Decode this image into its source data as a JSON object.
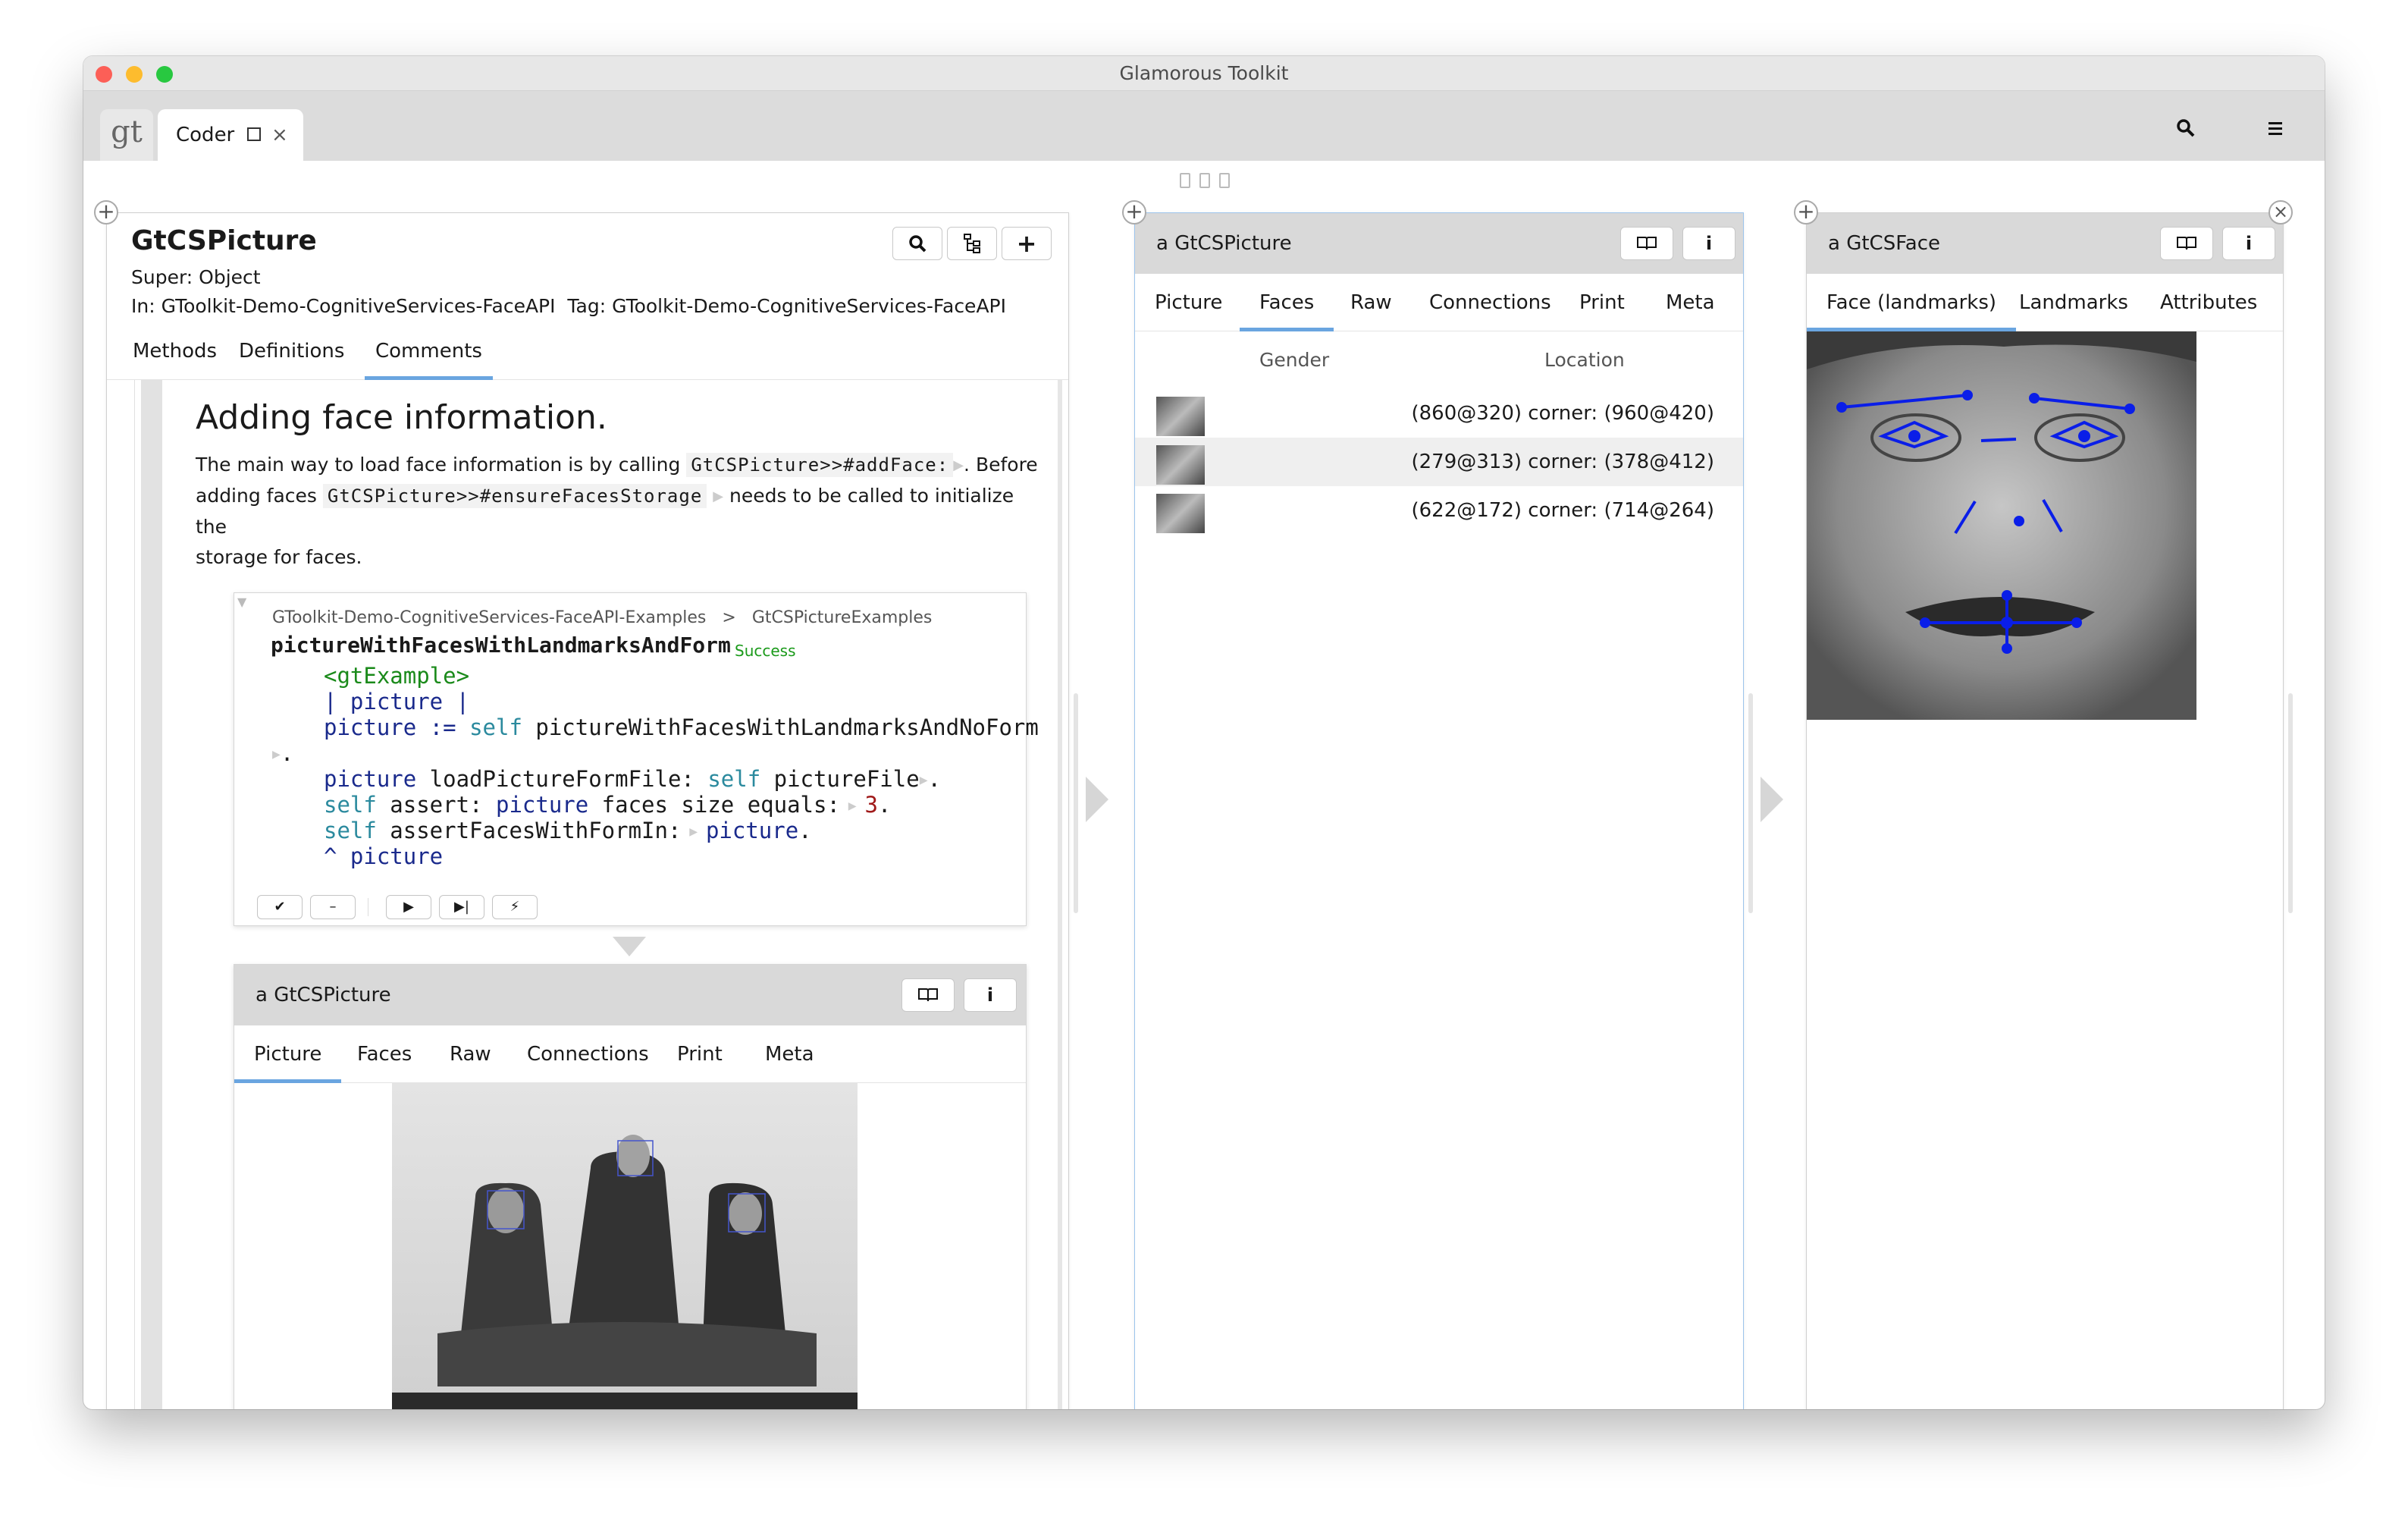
{
  "window": {
    "title": "Glamorous Toolkit"
  },
  "tabbar": {
    "logo": "gt",
    "tab_label": "Coder",
    "tab_close": "×"
  },
  "icons": {
    "search": "search-icon",
    "menu": "menu-icon",
    "book": "book-icon",
    "info": "info-icon",
    "plus": "plus-icon",
    "hierarchy": "hierarchy-icon",
    "close": "close-icon"
  },
  "coder": {
    "class_name": "GtCSPicture",
    "super": "Super: Object",
    "package_info": "In: GToolkit-Demo-CognitiveServices-FaceAPI  Tag: GToolkit-Demo-CognitiveServices-FaceAPI",
    "tabs": [
      "Methods",
      "Definitions",
      "Comments"
    ],
    "comment": {
      "heading": "Adding face information.",
      "line1_pre": "The main way to load face information is by calling",
      "code1": "GtCSPicture>>#addFace:",
      "line1_post": ". Before",
      "line2_pre": "adding faces",
      "code2": "GtCSPicture>>#ensureFacesStorage",
      "line2_post": "needs to be called to initialize the",
      "line3": "storage for faces."
    },
    "example": {
      "breadcrumb_package": "GToolkit-Demo-CognitiveServices-FaceAPI-Examples",
      "breadcrumb_sep": ">",
      "breadcrumb_class": "GtCSPictureExamples",
      "method_name": "pictureWithFacesWithLandmarksAndForm",
      "status": "Success",
      "code": {
        "l1": "<gtExample>",
        "l2a": "| ",
        "l2b": "picture",
        "l2c": " |",
        "l3a": "picture",
        "l3b": " := ",
        "l3c": "self",
        "l3d": " pictureWithFacesWithLandmarksAndNoForm",
        "l4": ".",
        "l5a": "picture",
        "l5b": " loadPictureFormFile: ",
        "l5c": "self",
        "l5d": " pictureFile",
        "l5e": ".",
        "l6a": "self",
        "l6b": " assert: ",
        "l6c": "picture",
        "l6d": " faces size equals:",
        "l6e": "3",
        "l6f": ".",
        "l7a": "self",
        "l7b": " assertFacesWithFormIn:",
        "l7c": "picture",
        "l7d": ".",
        "l8a": "^ ",
        "l8b": "picture"
      },
      "buttons": [
        "✔",
        "–",
        "▶",
        "▶|",
        "⚡"
      ]
    },
    "inspector": {
      "title": "a GtCSPicture",
      "tabs": [
        "Picture",
        "Faces",
        "Raw",
        "Connections",
        "Print",
        "Meta"
      ]
    }
  },
  "faces_pane": {
    "title": "a GtCSPicture",
    "tabs": [
      "Picture",
      "Faces",
      "Raw",
      "Connections",
      "Print",
      "Meta"
    ],
    "columns": [
      "Gender",
      "Location"
    ],
    "rows": [
      {
        "gender": "",
        "location": "(860@320) corner: (960@420)"
      },
      {
        "gender": "",
        "location": "(279@313) corner: (378@412)"
      },
      {
        "gender": "",
        "location": "(622@172) corner: (714@264)"
      }
    ]
  },
  "face_pane": {
    "title": "a GtCSFace",
    "tabs": [
      "Face (landmarks)",
      "Landmarks",
      "Attributes"
    ]
  },
  "colors": {
    "accent": "#6aa5e0",
    "landmark": "#0a1ee8",
    "success": "#1a9a1a"
  }
}
